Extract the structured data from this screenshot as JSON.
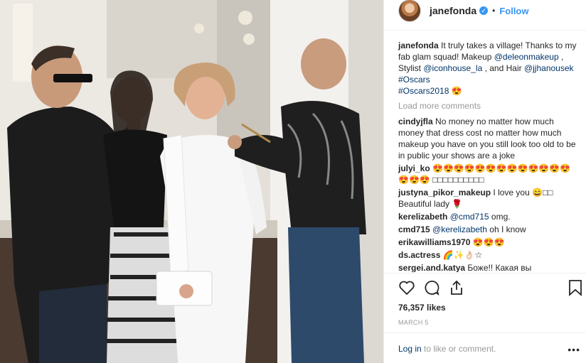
{
  "post": {
    "username": "janefonda",
    "verified_badge": "✓",
    "follow_label": "Follow",
    "caption": {
      "username": "janefonda",
      "text1": " It truly takes a village! Thanks to my fab glam squad! Makeup ",
      "m1": "@deleonmakeup",
      "text2": " , Stylist ",
      "m2": "@iconhouse_la",
      "text3": " , and Hair ",
      "m3": "@jjhanousek",
      "text4": " ",
      "tag1": "#Oscars",
      "tag2": "#Oscars2018",
      "emoji": " 😍"
    },
    "load_more": "Load more comments",
    "comments": [
      {
        "user": "cindyjfla",
        "text": " No money no matter how much money that dress cost no matter how much makeup you have on you still look too old to be in public your shows are a joke"
      },
      {
        "user": "julyi_ko",
        "text": " 😍😍😍😍😍😍😍😍😍😍😍😍😍😍😍😍 □□□□□□□□□□"
      },
      {
        "user": "justyna_pikor_makeup",
        "text": " I love you 😄□□ Beautiful lady 🌹"
      },
      {
        "user": "kerelizabeth",
        "mention": " @cmd715",
        "text": " omg."
      },
      {
        "user": "cmd715",
        "mention": " @kerelizabeth",
        "text": " oh I know"
      },
      {
        "user": "erikawilliams1970",
        "text": " 😍😍😍"
      },
      {
        "user": "ds.actress",
        "text": " 🌈✨👌🏻☆"
      },
      {
        "user": "sergei.and.katya",
        "text": " Боже!! Какая вы красивая!!!!"
      }
    ],
    "likes": "76,357 likes",
    "date": "MARCH 5",
    "login_link": "Log in",
    "login_rest": " to like or comment.",
    "more_icon": "•••",
    "icons": [
      "heart-icon",
      "comment-icon",
      "share-icon",
      "bookmark-icon"
    ]
  }
}
